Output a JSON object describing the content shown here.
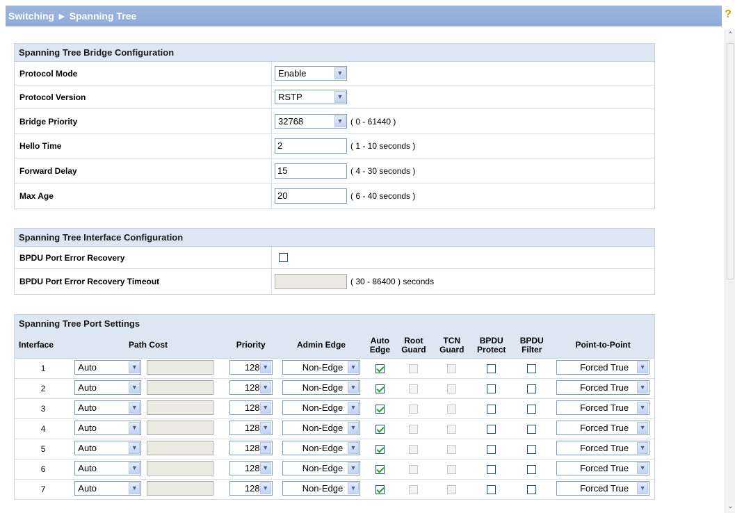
{
  "header": {
    "section": "Switching",
    "separator": "►",
    "page": "Spanning Tree",
    "help_glyph": "?"
  },
  "bridge": {
    "heading": "Spanning Tree Bridge Configuration",
    "protocol_mode_label": "Protocol Mode",
    "protocol_mode_value": "Enable",
    "protocol_version_label": "Protocol Version",
    "protocol_version_value": "RSTP",
    "bridge_priority_label": "Bridge Priority",
    "bridge_priority_value": "32768",
    "bridge_priority_range": "( 0 - 61440 )",
    "hello_time_label": "Hello Time",
    "hello_time_value": "2",
    "hello_time_range": "( 1 - 10 seconds )",
    "forward_delay_label": "Forward Delay",
    "forward_delay_value": "15",
    "forward_delay_range": "( 4 - 30 seconds )",
    "max_age_label": "Max Age",
    "max_age_value": "20",
    "max_age_range": "( 6 - 40 seconds )"
  },
  "interface_cfg": {
    "heading": "Spanning Tree Interface Configuration",
    "bpdu_recovery_label": "BPDU Port Error Recovery",
    "bpdu_recovery_checked": false,
    "bpdu_timeout_label": "BPDU Port Error Recovery Timeout",
    "bpdu_timeout_value": "",
    "bpdu_timeout_range": "( 30 - 86400 ) seconds"
  },
  "ports": {
    "heading": "Spanning Tree Port Settings",
    "columns": {
      "interface": "Interface",
      "path_cost": "Path Cost",
      "priority": "Priority",
      "admin_edge": "Admin Edge",
      "auto_edge_1": "Auto",
      "auto_edge_2": "Edge",
      "root_guard_1": "Root",
      "root_guard_2": "Guard",
      "tcn_guard_1": "TCN",
      "tcn_guard_2": "Guard",
      "bpdu_protect_1": "BPDU",
      "bpdu_protect_2": "Protect",
      "bpdu_filter_1": "BPDU",
      "bpdu_filter_2": "Filter",
      "point_to_point": "Point-to-Point"
    },
    "rows": [
      {
        "interface": "1",
        "path_cost_mode": "Auto",
        "path_cost": "",
        "priority": "128",
        "admin_edge": "Non-Edge",
        "auto_edge": true,
        "root_guard": false,
        "tcn_guard": false,
        "bpdu_protect": false,
        "bpdu_filter": false,
        "point_to_point": "Forced True"
      },
      {
        "interface": "2",
        "path_cost_mode": "Auto",
        "path_cost": "",
        "priority": "128",
        "admin_edge": "Non-Edge",
        "auto_edge": true,
        "root_guard": false,
        "tcn_guard": false,
        "bpdu_protect": false,
        "bpdu_filter": false,
        "point_to_point": "Forced True"
      },
      {
        "interface": "3",
        "path_cost_mode": "Auto",
        "path_cost": "",
        "priority": "128",
        "admin_edge": "Non-Edge",
        "auto_edge": true,
        "root_guard": false,
        "tcn_guard": false,
        "bpdu_protect": false,
        "bpdu_filter": false,
        "point_to_point": "Forced True"
      },
      {
        "interface": "4",
        "path_cost_mode": "Auto",
        "path_cost": "",
        "priority": "128",
        "admin_edge": "Non-Edge",
        "auto_edge": true,
        "root_guard": false,
        "tcn_guard": false,
        "bpdu_protect": false,
        "bpdu_filter": false,
        "point_to_point": "Forced True"
      },
      {
        "interface": "5",
        "path_cost_mode": "Auto",
        "path_cost": "",
        "priority": "128",
        "admin_edge": "Non-Edge",
        "auto_edge": true,
        "root_guard": false,
        "tcn_guard": false,
        "bpdu_protect": false,
        "bpdu_filter": false,
        "point_to_point": "Forced True"
      },
      {
        "interface": "6",
        "path_cost_mode": "Auto",
        "path_cost": "",
        "priority": "128",
        "admin_edge": "Non-Edge",
        "auto_edge": true,
        "root_guard": false,
        "tcn_guard": false,
        "bpdu_protect": false,
        "bpdu_filter": false,
        "point_to_point": "Forced True"
      },
      {
        "interface": "7",
        "path_cost_mode": "Auto",
        "path_cost": "",
        "priority": "128",
        "admin_edge": "Non-Edge",
        "auto_edge": true,
        "root_guard": false,
        "tcn_guard": false,
        "bpdu_protect": false,
        "bpdu_filter": false,
        "point_to_point": "Forced True"
      }
    ]
  },
  "scrollbar": {
    "up_glyph": "⌃",
    "down_glyph": "⌄"
  },
  "colors": {
    "header_band": "#9bb6df",
    "panel_head": "#dde7f4",
    "panel_border": "#c9d3e3"
  }
}
